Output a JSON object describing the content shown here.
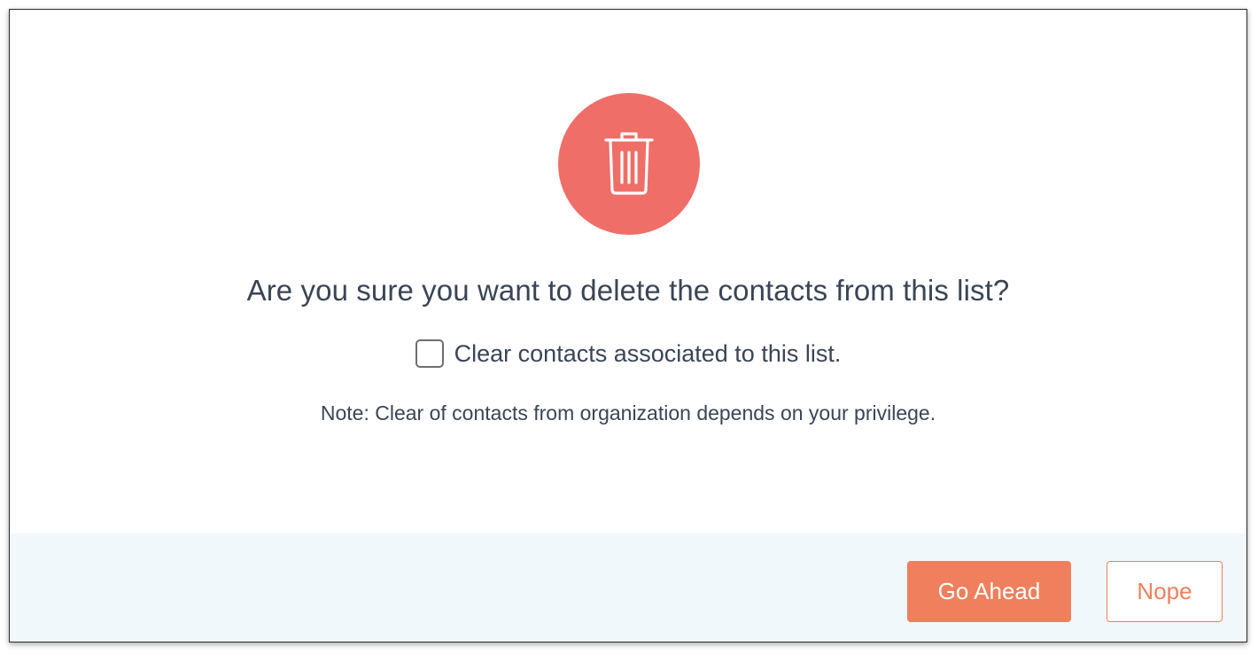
{
  "dialog": {
    "icon": "trash-icon",
    "title": "Are you sure you want to delete the contacts from this list?",
    "checkbox": {
      "label": "Clear contacts associated to this list.",
      "checked": false
    },
    "note": "Note: Clear of contacts from organization depends on your privilege.",
    "buttons": {
      "confirm_label": "Go Ahead",
      "cancel_label": "Nope"
    }
  },
  "colors": {
    "icon_bg": "#ef6e68",
    "accent": "#ef7f5d",
    "text": "#3a4555",
    "footer_bg": "#f1f8fb"
  }
}
